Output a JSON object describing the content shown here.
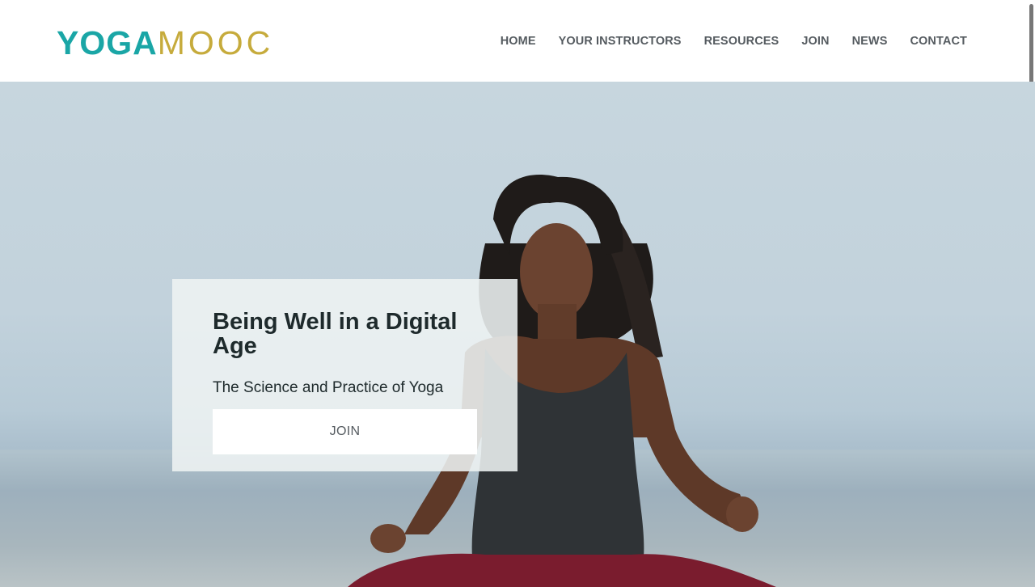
{
  "header": {
    "logo": {
      "part1": "YOGA",
      "part2": "MOOC",
      "colors": {
        "part1": "#1aa6a6",
        "part2": "#c6ab3c"
      }
    },
    "nav": [
      {
        "label": "HOME"
      },
      {
        "label": "YOUR INSTRUCTORS"
      },
      {
        "label": "RESOURCES"
      },
      {
        "label": "JOIN"
      },
      {
        "label": "NEWS"
      },
      {
        "label": "CONTACT"
      }
    ]
  },
  "hero": {
    "title": "Being Well in a Digital Age",
    "subtitle": "The Science and Practice of Yoga",
    "cta_label": "JOIN",
    "image": "woman-meditating-on-beach"
  },
  "colors": {
    "text_dark": "#1e2a2c",
    "nav_text": "#555b60",
    "card_bg": "#eef2f3"
  }
}
